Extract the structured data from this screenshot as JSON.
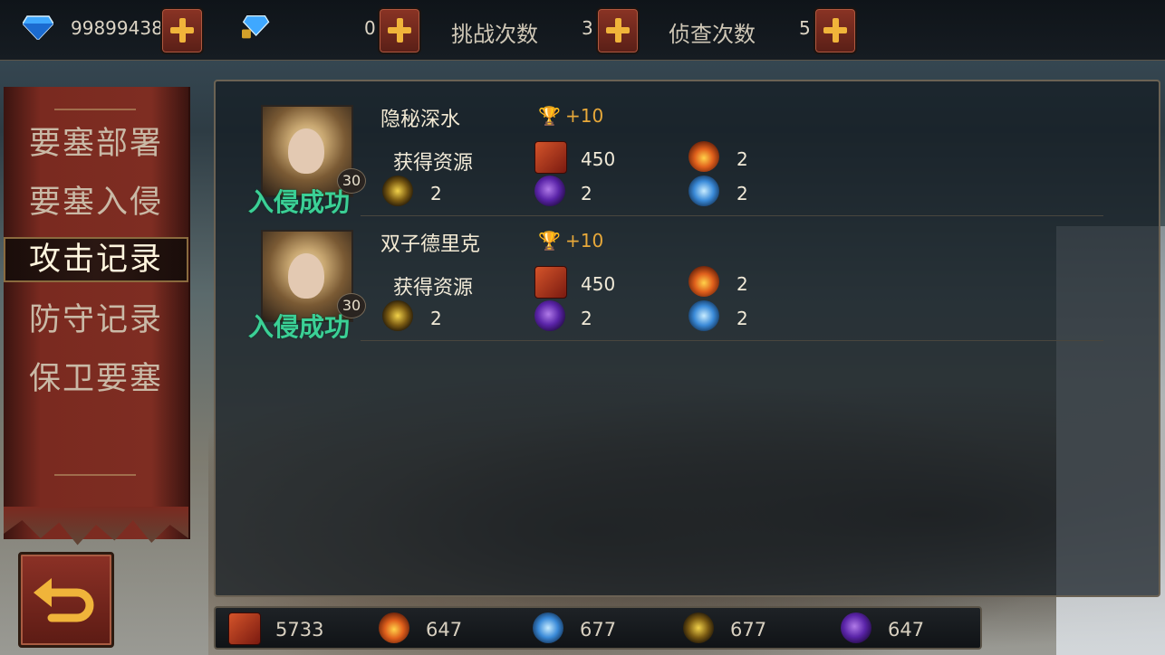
{
  "topbar": {
    "diamonds": "99899438",
    "locked_diamonds": "0",
    "challenge_count": "3",
    "challenge_label": "挑战次数",
    "scout_count": "5",
    "scout_label": "侦查次数"
  },
  "sidebar": {
    "items": [
      {
        "label": "要塞部署"
      },
      {
        "label": "要塞入侵"
      },
      {
        "label": "攻击记录",
        "active": true
      },
      {
        "label": "防守记录"
      },
      {
        "label": "保卫要塞"
      }
    ]
  },
  "records": [
    {
      "name": "隐秘深水",
      "trophy": "+10",
      "level": "30",
      "status": "入侵成功",
      "resources_label": "获得资源",
      "resources": {
        "book": "450",
        "fire": "2",
        "gold": "2",
        "void": "2",
        "ice": "2"
      }
    },
    {
      "name": "双子德里克",
      "trophy": "+10",
      "level": "30",
      "status": "入侵成功",
      "resources_label": "获得资源",
      "resources": {
        "book": "450",
        "fire": "2",
        "gold": "2",
        "void": "2",
        "ice": "2"
      }
    }
  ],
  "totals": {
    "book": "5733",
    "fire": "647",
    "ice": "677",
    "gold": "677",
    "void": "647"
  },
  "colors": {
    "status_success": "#3bd096",
    "accent_gold": "#f0b43a",
    "banner_red": "#7e2d22"
  }
}
